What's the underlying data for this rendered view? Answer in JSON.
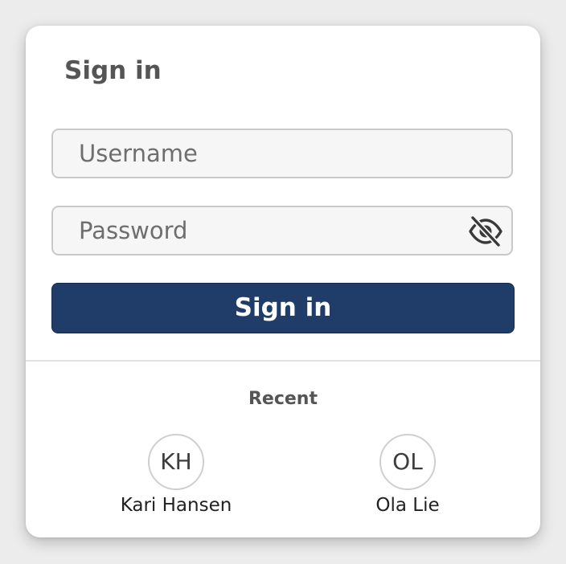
{
  "form": {
    "title": "Sign in",
    "username_placeholder": "Username",
    "password_placeholder": "Password",
    "toggle_icon": "eye-slash-icon",
    "submit_label": "Sign in"
  },
  "recent": {
    "label": "Recent",
    "accounts": [
      {
        "initials": "KH",
        "name": "Kari Hansen"
      },
      {
        "initials": "OL",
        "name": "Ola Lie"
      }
    ]
  },
  "colors": {
    "primary_button": "#1f3d68",
    "title_text": "#555555",
    "field_background": "#f6f6f6",
    "field_border": "#c9c9c9"
  }
}
